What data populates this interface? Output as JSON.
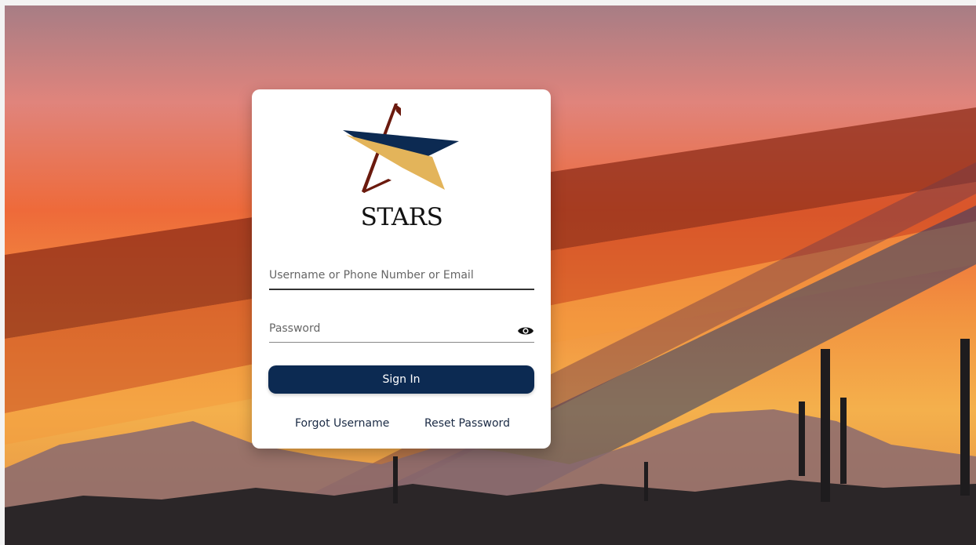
{
  "brand": {
    "name": "STARS"
  },
  "login": {
    "username_placeholder": "Username or Phone Number or Email",
    "password_placeholder": "Password",
    "signin_label": "Sign In",
    "forgot_username_label": "Forgot Username",
    "reset_password_label": "Reset Password"
  },
  "icons": {
    "password_toggle": "eye-icon"
  },
  "colors": {
    "button": "#0c2a52",
    "logo_navy": "#0c2a52",
    "logo_maroon": "#6b1a0e",
    "logo_gold": "#e3b45a"
  }
}
